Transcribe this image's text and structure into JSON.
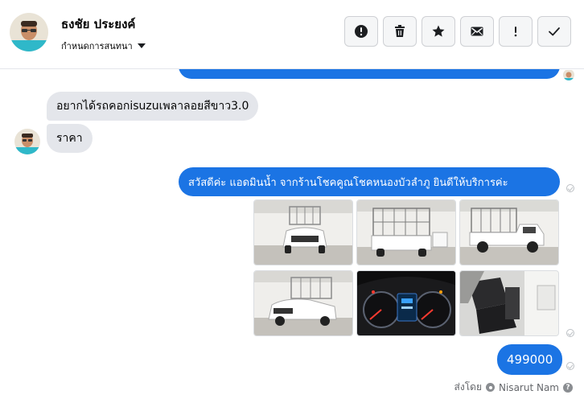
{
  "header": {
    "contact_name": "ธงชัย ประยงค์",
    "conversation_settings": "กำหนดการสนทนา",
    "actions": [
      {
        "name": "report-button",
        "icon": "exclamation-circle-icon"
      },
      {
        "name": "delete-button",
        "icon": "trash-icon"
      },
      {
        "name": "star-button",
        "icon": "star-icon"
      },
      {
        "name": "mail-button",
        "icon": "envelope-icon"
      },
      {
        "name": "spam-button",
        "icon": "exclamation-icon"
      },
      {
        "name": "done-button",
        "icon": "checkmark-icon"
      }
    ]
  },
  "messages": {
    "incoming_1": "อยากได้รถคอกisuzuเพลาลอยสีขาว3.0",
    "incoming_2": "ราคา",
    "outgoing_greeting": "สวัสดีค่ะ แอดมินน้ำ จากร้านโชคคูณโชคหนองบัวลำภู ยินดีให้บริการค่ะ",
    "outgoing_price": "499000",
    "photos": [
      "white-pickup-front-cage-photo",
      "white-pickup-rear-cage-photo",
      "white-pickup-side-cage-photo",
      "white-pickup-front-angle-photo",
      "dashboard-gauges-photo",
      "interior-seats-photo"
    ]
  },
  "footer": {
    "sent_by_label": "ส่งโดย",
    "sender_name": "Nisarut Nam",
    "help_glyph": "?"
  },
  "colors": {
    "accent_blue": "#1b74e4",
    "incoming_bubble": "#e4e6eb"
  }
}
